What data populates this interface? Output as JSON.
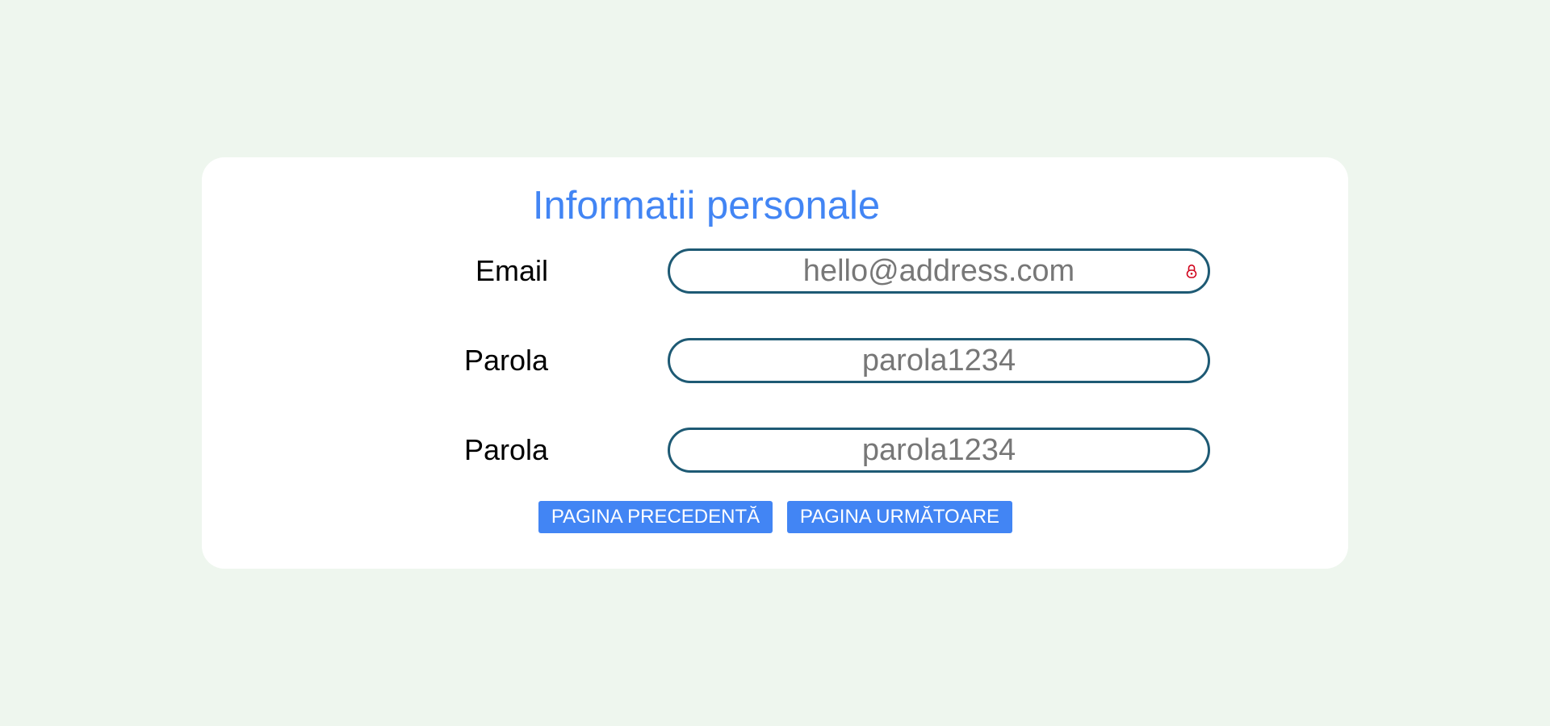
{
  "form": {
    "title": "Informatii personale",
    "fields": [
      {
        "label": "Email",
        "value": "hello@address.com",
        "placeholder": "hello@address.com"
      },
      {
        "label": "Parola",
        "value": "parola1234",
        "placeholder": "parola1234"
      },
      {
        "label": "Parola",
        "value": "parola1234",
        "placeholder": "parola1234"
      }
    ],
    "buttons": {
      "previous_label": "PAGINA PRECEDENTĂ",
      "next_label": "PAGINA URMĂTOARE"
    }
  },
  "icons": {
    "email_field_icon": "password-manager-lock-icon"
  },
  "colors": {
    "background": "#eef6ee",
    "card": "#ffffff",
    "title": "#4285f4",
    "field_border": "#1e5a74",
    "field_text": "#777777",
    "button_bg": "#4285f4",
    "button_text": "#ffffff",
    "lock_icon": "#d0021b"
  }
}
